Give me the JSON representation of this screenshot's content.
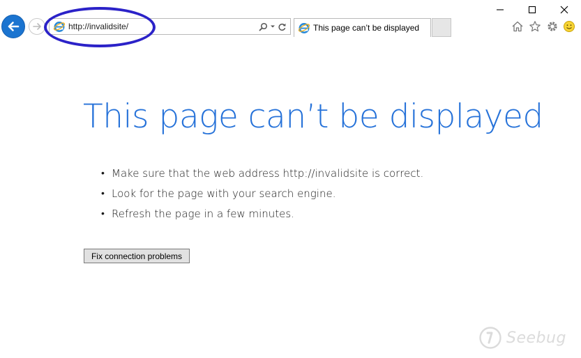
{
  "browser": {
    "address_url": "http://invalidsite/",
    "tab_title": "This page can’t be displayed",
    "icons": {
      "back": "back-arrow-icon",
      "forward": "forward-arrow-icon",
      "page": "ie-page-icon",
      "search": "search-icon",
      "dropdown": "chevron-down-icon",
      "refresh": "refresh-icon",
      "home": "home-icon",
      "favorites": "star-icon",
      "tools": "gear-icon",
      "feedback": "smiley-icon",
      "minimize": "minimize-icon",
      "maximize": "maximize-icon",
      "close": "close-icon"
    }
  },
  "page": {
    "title": "This page can’t be displayed",
    "bullet": "•",
    "tips": [
      "Make sure that the web address http://invalidsite is correct.",
      "Look for the page with your search engine.",
      "Refresh the page in a few minutes."
    ],
    "fix_button_label": "Fix connection problems"
  },
  "watermark": {
    "text": "Seebug"
  },
  "colors": {
    "title_blue": "#2672d9",
    "back_button_blue": "#1b74d0",
    "annotation_ellipse": "#2b22c8"
  }
}
